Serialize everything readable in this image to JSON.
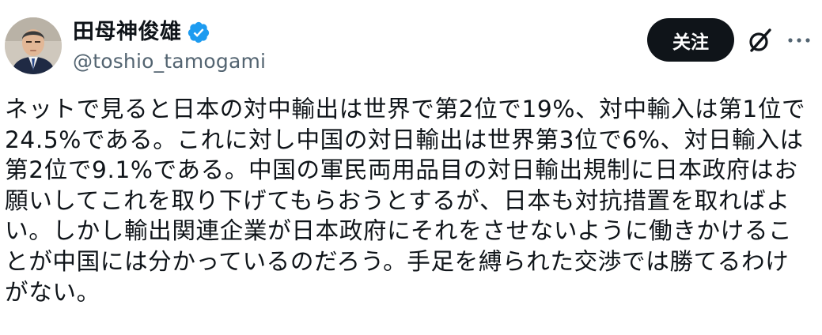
{
  "author": {
    "display_name": "田母神俊雄",
    "handle": "@toshio_tamogami",
    "verified": true
  },
  "actions": {
    "follow_label": "关注"
  },
  "post": {
    "lines": [
      "ネットで見ると日本の対中輸出は世界で第2位で19%、対中輸入は第1位で",
      "24.5%である。これに対し中国の対日輸出は世界第3位で6%、対日輸入は",
      "第2位で9.1%である。中国の軍民両用品目の対日輸出規制に日本政府はお",
      "願いしてこれを取り下げてもらおうとするが、日本も対抗措置を取ればよ",
      "い。しかし輸出関連企業が日本政府にそれをさせないように働きかけるこ",
      "とが中国には分かっているのだろう。手足を縛られた交渉では勝てるわけ",
      "がない。"
    ]
  },
  "colors": {
    "text": "#0f1419",
    "secondary_text": "#536471",
    "verified_badge": "#1d9bf0",
    "follow_button_bg": "#0f1419",
    "follow_button_text": "#ffffff"
  },
  "icons": {
    "verified": "verified-badge-icon",
    "grok": "grok-icon",
    "more": "more-options-icon"
  }
}
